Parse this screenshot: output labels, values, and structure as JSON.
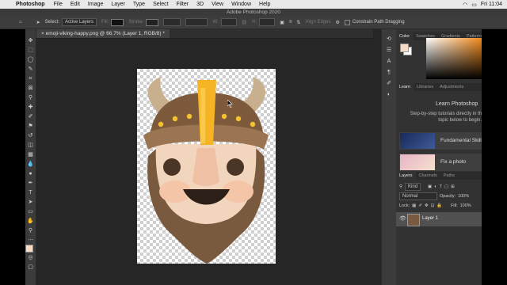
{
  "menubar": {
    "app_name": "Photoshop",
    "items": [
      "File",
      "Edit",
      "Image",
      "Layer",
      "Type",
      "Select",
      "Filter",
      "3D",
      "View",
      "Window",
      "Help"
    ],
    "clock": "Fri 11:04"
  },
  "titlebar": {
    "title": "Adobe Photoshop 2020"
  },
  "options": {
    "select_label": "Select:",
    "select_value": "Active Layers",
    "fill_label": "Fill:",
    "stroke_label": "Stroke:",
    "w_label": "W:",
    "h_label": "H:",
    "align_edges": "Align Edges",
    "constrain": "Constrain Path Dragging"
  },
  "document": {
    "tab_title": "emoji-viking-happy.png @ 66.7% (Layer 1, RGB/8) *"
  },
  "panels": {
    "color_tabs": [
      "Color",
      "Swatches",
      "Gradients",
      "Patterns"
    ],
    "learn_tabs": [
      "Learn",
      "Libraries",
      "Adjustments"
    ],
    "learn_title": "Learn Photoshop",
    "learn_desc": "Step-by-step tutorials directly in th topic below to begin.",
    "cards": [
      "Fundamental Skills",
      "Fix a photo"
    ],
    "layer_tabs": [
      "Layers",
      "Channels",
      "Paths"
    ],
    "kind_label": "Kind",
    "blend_mode": "Normal",
    "opacity_label": "Opacity:",
    "opacity_value": "100%",
    "lock_label": "Lock:",
    "fill_label": "Fill:",
    "fill_value": "100%",
    "layer_name": "Layer 1"
  },
  "colors": {
    "accent_orange": "#f28a1b",
    "fg_color": "#f4dcc6"
  }
}
